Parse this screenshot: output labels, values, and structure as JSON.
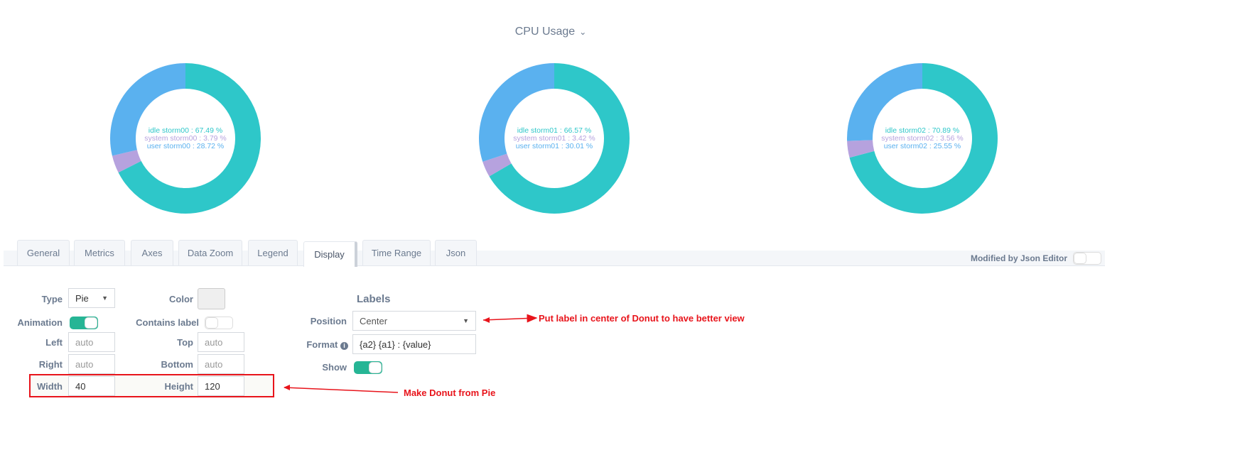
{
  "chart_title": "CPU Usage",
  "colors": {
    "idle": "#2ec7c9",
    "system": "#b6a2de",
    "user": "#5ab1ef",
    "accent": "#26b595",
    "annotation": "#e8141b"
  },
  "chart_data": [
    {
      "type": "pie",
      "host": "storm00",
      "slices": [
        {
          "name": "idle",
          "label": "idle storm00 : 67.49 %",
          "value": 67.49
        },
        {
          "name": "system",
          "label": "system storm00 : 3.79 %",
          "value": 3.79
        },
        {
          "name": "user",
          "label": "user storm00 : 28.72 %",
          "value": 28.72
        }
      ]
    },
    {
      "type": "pie",
      "host": "storm01",
      "slices": [
        {
          "name": "idle",
          "label": "idle storm01 : 66.57 %",
          "value": 66.57
        },
        {
          "name": "system",
          "label": "system storm01 : 3.42 %",
          "value": 3.42
        },
        {
          "name": "user",
          "label": "user storm01 : 30.01 %",
          "value": 30.01
        }
      ]
    },
    {
      "type": "pie",
      "host": "storm02",
      "slices": [
        {
          "name": "idle",
          "label": "idle storm02 : 70.89 %",
          "value": 70.89
        },
        {
          "name": "system",
          "label": "system storm02 : 3.56 %",
          "value": 3.56
        },
        {
          "name": "user",
          "label": "user storm02 : 25.55 %",
          "value": 25.55
        }
      ]
    }
  ],
  "tabs": [
    "General",
    "Metrics",
    "Axes",
    "Data Zoom",
    "Legend",
    "Display",
    "Time Range",
    "Json"
  ],
  "modified_label": "Modified by Json Editor",
  "form": {
    "type_label": "Type",
    "type_value": "Pie",
    "color_label": "Color",
    "animation_label": "Animation",
    "contains_label": "Contains label",
    "left_label": "Left",
    "left_ph": "auto",
    "top_label": "Top",
    "top_ph": "auto",
    "right_label": "Right",
    "right_ph": "auto",
    "bottom_label": "Bottom",
    "bottom_ph": "auto",
    "width_label": "Width",
    "width_value": "40",
    "height_label": "Height",
    "height_value": "120"
  },
  "labels": {
    "heading": "Labels",
    "position_label": "Position",
    "position_value": "Center",
    "format_label": "Format",
    "format_value": "{a2} {a1} : {value}",
    "show_label": "Show"
  },
  "annotations": {
    "position_note": "Put label in center of Donut to have better view",
    "size_note": "Make Donut from Pie"
  }
}
